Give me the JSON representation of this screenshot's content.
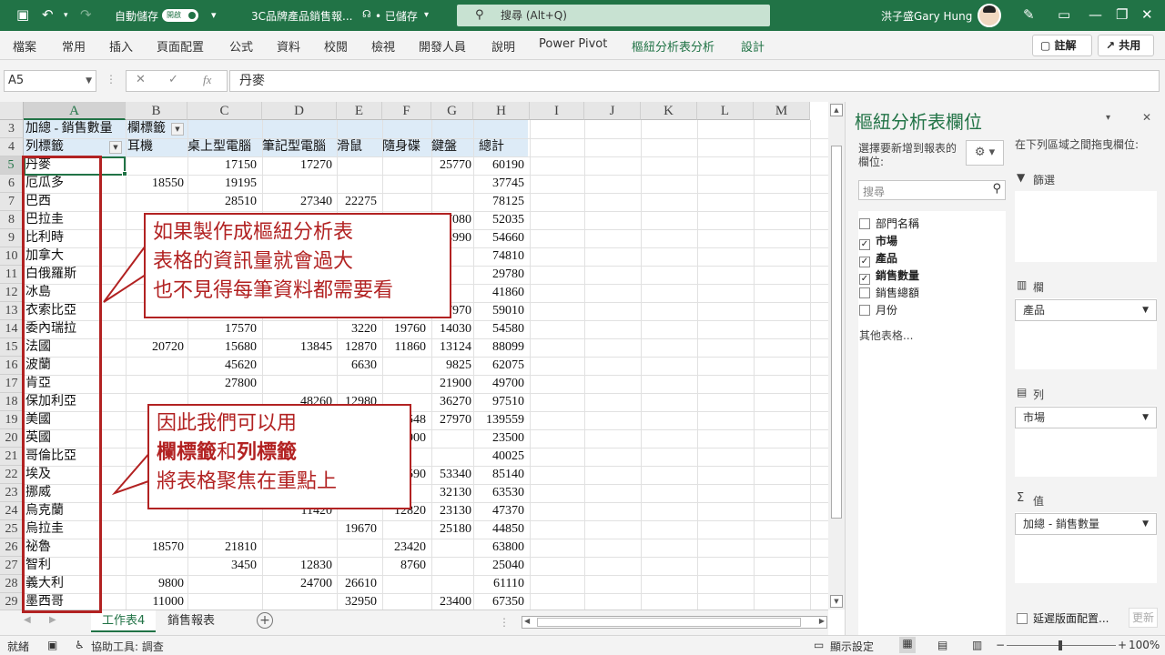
{
  "titlebar": {
    "autosave_label": "自動儲存",
    "autosave_state": "開啟",
    "filename": "3C品牌產品銷售報...",
    "saved_status": "• 已儲存",
    "search_placeholder": "搜尋 (Alt+Q)",
    "user_name": "洪子盛Gary Hung"
  },
  "ribbon": {
    "tabs": [
      "檔案",
      "常用",
      "插入",
      "頁面配置",
      "公式",
      "資料",
      "校閱",
      "檢視",
      "開發人員",
      "說明",
      "Power Pivot",
      "樞紐分析表分析",
      "設計"
    ],
    "comments_label": "註解",
    "share_label": "共用"
  },
  "formula_bar": {
    "cell_ref": "A5",
    "fx": "fx",
    "content": "丹麥"
  },
  "columns": [
    "A",
    "B",
    "C",
    "D",
    "E",
    "F",
    "G",
    "H",
    "I",
    "J",
    "K",
    "L",
    "M"
  ],
  "rows": [
    "3",
    "4",
    "5",
    "6",
    "7",
    "8",
    "9",
    "10",
    "11",
    "12",
    "13",
    "14",
    "15",
    "16",
    "17",
    "18",
    "19",
    "20",
    "21",
    "22",
    "23",
    "24",
    "25",
    "26",
    "27",
    "28",
    "29"
  ],
  "pivot": {
    "title_cell": "加總 - 銷售數量",
    "col_label": "欄標籤",
    "row_label": "列標籤",
    "headers": [
      "耳機",
      "桌上型電腦",
      "筆記型電腦",
      "滑鼠",
      "隨身碟",
      "鍵盤",
      "總計"
    ],
    "data": [
      [
        "丹麥",
        "",
        "17150",
        "17270",
        "",
        "",
        "25770",
        "60190"
      ],
      [
        "厄瓜多",
        "18550",
        "19195",
        "",
        "",
        "",
        "",
        "37745"
      ],
      [
        "巴西",
        "",
        "28510",
        "27340",
        "22275",
        "",
        "",
        "78125"
      ],
      [
        "巴拉圭",
        "",
        "",
        "",
        "",
        "",
        "7080",
        "52035"
      ],
      [
        "比利時",
        "",
        "",
        "",
        "",
        "",
        "3990",
        "54660"
      ],
      [
        "加拿大",
        "",
        "",
        "",
        "",
        "",
        "",
        "74810"
      ],
      [
        "白俄羅斯",
        "",
        "",
        "",
        "",
        "",
        "",
        "29780"
      ],
      [
        "冰島",
        "",
        "",
        "",
        "",
        "",
        "",
        "41860"
      ],
      [
        "衣索比亞",
        "",
        "",
        "",
        "",
        "",
        "7970",
        "59010"
      ],
      [
        "委內瑞拉",
        "",
        "17570",
        "",
        "3220",
        "19760",
        "14030",
        "54580"
      ],
      [
        "法國",
        "20720",
        "15680",
        "13845",
        "12870",
        "11860",
        "13124",
        "88099"
      ],
      [
        "波蘭",
        "",
        "45620",
        "",
        "6630",
        "",
        "9825",
        "62075"
      ],
      [
        "肯亞",
        "",
        "27800",
        "",
        "",
        "",
        "21900",
        "49700"
      ],
      [
        "保加利亞",
        "",
        "",
        "48260",
        "12980",
        "",
        "36270",
        "97510"
      ],
      [
        "美國",
        "",
        "",
        "",
        "",
        "548",
        "27970",
        "139559"
      ],
      [
        "英國",
        "",
        "",
        "",
        "",
        "900",
        "",
        "23500"
      ],
      [
        "哥倫比亞",
        "",
        "",
        "",
        "",
        "",
        "",
        "40025"
      ],
      [
        "埃及",
        "",
        "",
        "",
        "",
        "590",
        "53340",
        "85140"
      ],
      [
        "挪威",
        "",
        "",
        "",
        "",
        "",
        "32130",
        "63530"
      ],
      [
        "烏克蘭",
        "",
        "",
        "11420",
        "",
        "12820",
        "23130",
        "47370"
      ],
      [
        "烏拉圭",
        "",
        "",
        "",
        "19670",
        "",
        "25180",
        "44850"
      ],
      [
        "祕魯",
        "18570",
        "21810",
        "",
        "",
        "23420",
        "",
        "63800"
      ],
      [
        "智利",
        "",
        "3450",
        "12830",
        "",
        "8760",
        "",
        "25040"
      ],
      [
        "義大利",
        "9800",
        "",
        "24700",
        "26610",
        "",
        "",
        "61110"
      ],
      [
        "墨西哥",
        "11000",
        "",
        "",
        "32950",
        "",
        "23400",
        "67350"
      ]
    ]
  },
  "callout1": {
    "line1": "如果製作成樞紐分析表",
    "line2": "表格的資訊量就會過大",
    "line3": "也不見得每筆資料都需要看"
  },
  "callout2": {
    "line1": "因此我們可以用",
    "bold1": "欄標籤",
    "mid": "和",
    "bold2": "列標籤",
    "line3": "將表格聚焦在重點上"
  },
  "sheets": [
    "工作表4",
    "銷售報表"
  ],
  "status": {
    "ready": "就緒",
    "accessibility": "協助工具: 調查",
    "display_settings": "顯示設定",
    "zoom": "100%"
  },
  "panel": {
    "title": "樞紐分析表欄位",
    "choose_label": "選擇要新增到報表的欄位:",
    "drag_label": "在下列區域之間拖曳欄位:",
    "search_placeholder": "搜尋",
    "fields": [
      {
        "name": "部門名稱",
        "checked": false
      },
      {
        "name": "市場",
        "checked": true
      },
      {
        "name": "產品",
        "checked": true
      },
      {
        "name": "銷售數量",
        "checked": true
      },
      {
        "name": "銷售總額",
        "checked": false
      },
      {
        "name": "月份",
        "checked": false
      }
    ],
    "more_tables": "其他表格...",
    "filter_label": "篩選",
    "columns_label": "欄",
    "columns_value": "產品",
    "rows_label": "列",
    "rows_value": "市場",
    "values_label": "值",
    "values_value": "加總 - 銷售數量",
    "defer_label": "延遲版面配置...",
    "update_label": "更新"
  },
  "colors": {
    "excel_green": "#217346",
    "callout_red": "#b22222",
    "pivot_header": "#ddebf7"
  }
}
